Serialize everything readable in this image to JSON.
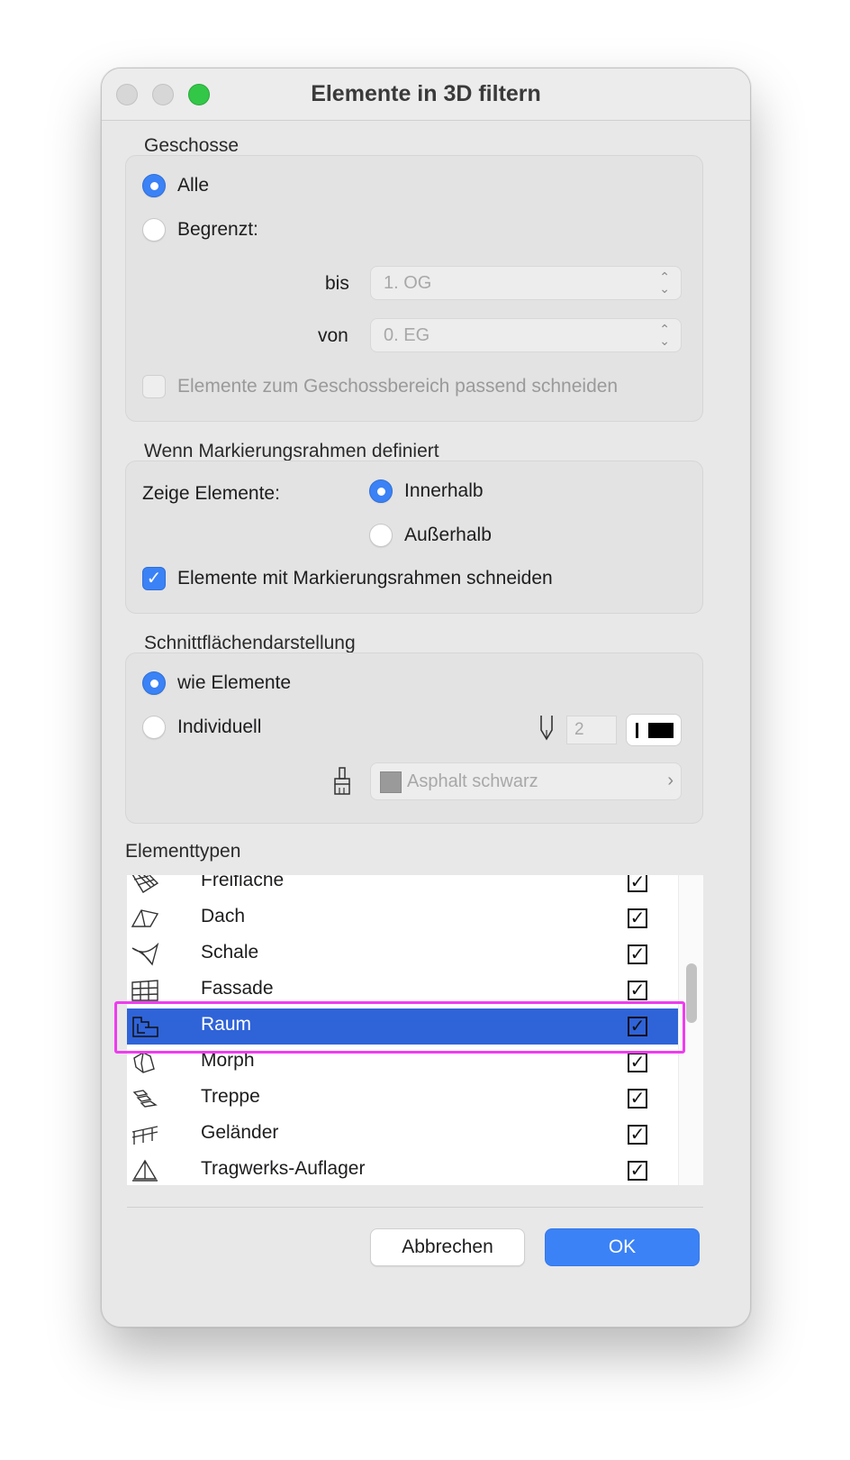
{
  "window": {
    "title": "Elemente in 3D filtern"
  },
  "geschosse": {
    "title": "Geschosse",
    "all_label": "Alle",
    "limited_label": "Begrenzt:",
    "selected": "Alle",
    "bis_label": "bis",
    "bis_value": "1. OG",
    "von_label": "von",
    "von_value": "0. EG",
    "cut_label": "Elemente zum Geschossbereich passend schneiden",
    "cut_checked": false
  },
  "marquee": {
    "title": "Wenn Markierungsrahmen definiert",
    "show_label": "Zeige Elemente:",
    "inside_label": "Innerhalb",
    "outside_label": "Außerhalb",
    "selected": "Innerhalb",
    "cut_label": "Elemente mit  Markierungsrahmen schneiden",
    "cut_checked": true
  },
  "cut_surface": {
    "title": "Schnittflächendarstellung",
    "as_elements_label": "wie Elemente",
    "individual_label": "Individuell",
    "selected": "wie Elemente",
    "pen_value": "2",
    "fill_label": "Asphalt schwarz"
  },
  "element_types": {
    "title": "Elementtypen",
    "items": [
      {
        "name": "Freifläche",
        "icon": "mesh-icon",
        "checked": true
      },
      {
        "name": "Dach",
        "icon": "roof-icon",
        "checked": true
      },
      {
        "name": "Schale",
        "icon": "shell-icon",
        "checked": true
      },
      {
        "name": "Fassade",
        "icon": "curtain-wall-icon",
        "checked": true
      },
      {
        "name": "Raum",
        "icon": "zone-icon",
        "checked": true,
        "selected": true
      },
      {
        "name": "Morph",
        "icon": "morph-icon",
        "checked": true
      },
      {
        "name": "Treppe",
        "icon": "stair-icon",
        "checked": true
      },
      {
        "name": "Geländer",
        "icon": "railing-icon",
        "checked": true
      },
      {
        "name": "Tragwerks-Auflager",
        "icon": "structural-support-icon",
        "checked": true
      }
    ]
  },
  "buttons": {
    "cancel": "Abbrechen",
    "ok": "OK"
  },
  "colors": {
    "accent": "#3b82f6",
    "selection": "#2f63d8",
    "highlight": "#ef3cf0"
  }
}
